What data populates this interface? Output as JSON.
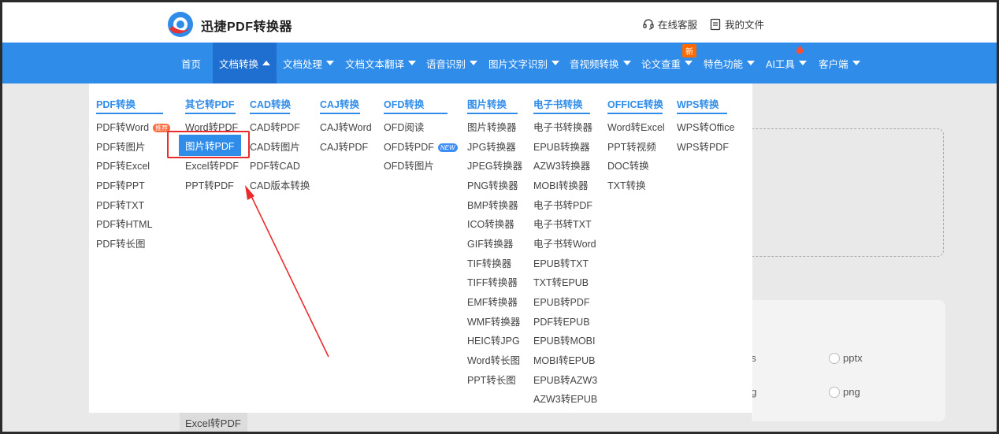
{
  "header": {
    "brand": "迅捷PDF转换器",
    "service": "在线客服",
    "my_files": "我的文件"
  },
  "nav": {
    "home": "首页",
    "doc_convert": "文档转换",
    "doc_process": "文档处理",
    "doc_translate": "文档文本翻译",
    "speech": "语音识别",
    "image_ocr": "图片文字识别",
    "av_convert": "音视频转换",
    "paper_check": "论文查重",
    "features": "特色功能",
    "ai_tools": "AI工具",
    "client": "客户端",
    "new_badge": "新"
  },
  "dropdown": {
    "col1": {
      "title": "PDF转换",
      "items": [
        "PDF转Word",
        "PDF转图片",
        "PDF转Excel",
        "PDF转PPT",
        "PDF转TXT",
        "PDF转HTML",
        "PDF转长图"
      ],
      "hot_tag": "推荐"
    },
    "col2": {
      "title": "其它转PDF",
      "items": [
        "Word转PDF",
        "图片转PDF",
        "Excel转PDF",
        "PPT转PDF"
      ]
    },
    "col3": {
      "title": "CAD转换",
      "items": [
        "CAD转PDF",
        "CAD转图片",
        "PDF转CAD",
        "CAD版本转换"
      ]
    },
    "col4": {
      "title": "CAJ转换",
      "items": [
        "CAJ转Word",
        "CAJ转PDF"
      ]
    },
    "col5": {
      "title": "OFD转换",
      "items": [
        "OFD阅读",
        "OFD转PDF",
        "OFD转图片"
      ],
      "new_tag": "NEW"
    },
    "col6": {
      "title": "图片转换",
      "items": [
        "图片转换器",
        "JPG转换器",
        "JPEG转换器",
        "PNG转换器",
        "BMP转换器",
        "ICO转换器",
        "GIF转换器",
        "TIF转换器",
        "TIFF转换器",
        "EMF转换器",
        "WMF转换器",
        "HEIC转JPG",
        "Word转长图",
        "PPT转长图"
      ]
    },
    "col7": {
      "title": "电子书转换",
      "items": [
        "电子书转换器",
        "EPUB转换器",
        "AZW3转换器",
        "MOBI转换器",
        "电子书转PDF",
        "电子书转TXT",
        "电子书转Word",
        "EPUB转TXT",
        "TXT转EPUB",
        "EPUB转PDF",
        "PDF转EPUB",
        "EPUB转MOBI",
        "MOBI转EPUB",
        "EPUB转AZW3",
        "AZW3转EPUB"
      ]
    },
    "col8": {
      "title": "OFFICE转换",
      "items": [
        "Word转Excel",
        "PPT转视频",
        "DOC转换",
        "TXT转换"
      ]
    },
    "col9": {
      "title": "WPS转换",
      "items": [
        "WPS转Office",
        "WPS转PDF"
      ]
    }
  },
  "background": {
    "opt_ds": "ds",
    "opt_pptx": "pptx",
    "opt_pg": "pg",
    "opt_png": "png",
    "excel_tab": "Excel转PDF"
  },
  "colors": {
    "nav_blue": "#2f8ce9",
    "nav_active": "#1e6fd0",
    "annotation_red": "#ea2b2b"
  }
}
